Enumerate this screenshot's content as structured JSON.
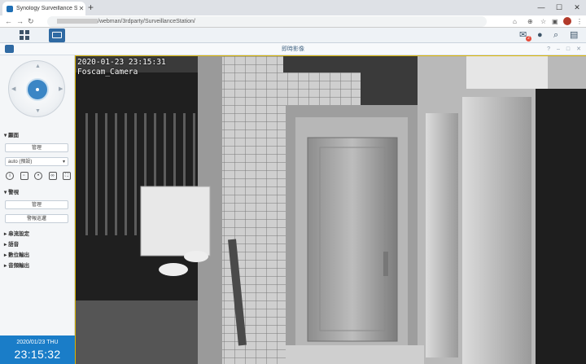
{
  "browser": {
    "tab_title": "Synology Surveillance Station",
    "url_path": "/webman/3rdparty/SurveillanceStation/",
    "new_tab": "+",
    "window_controls": [
      "—",
      "☐",
      "✕"
    ]
  },
  "app": {
    "title": "即時影像",
    "notification_count": "2",
    "window_controls": [
      "?",
      "–",
      "□",
      "✕"
    ]
  },
  "sidebar": {
    "section_view": "▾ 顯面",
    "manage_btn": "管理",
    "preset_select": "auto (預設)",
    "section_patrol": "▾ 警視",
    "patrol_manage_btn": "管理",
    "patrol_record_btn": "警報巡邏",
    "collapsed_sections": [
      "▸ 串流設定",
      "▸ 語音",
      "▸ 數位輸出",
      "▸ 音頻輸出"
    ]
  },
  "clock": {
    "date": "2020/01/23  THU",
    "time": "23:15:32"
  },
  "video": {
    "osd_timestamp": "2020-01-23 23:15:31",
    "osd_camera": "Foscam_Camera"
  }
}
